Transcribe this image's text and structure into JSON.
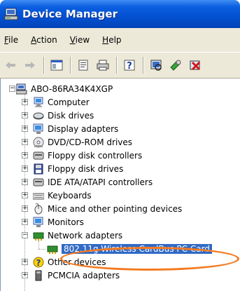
{
  "window": {
    "title": "Device Manager",
    "icon": "device-manager-icon"
  },
  "menu": {
    "items": [
      {
        "label": "File",
        "underline": "F",
        "rest": "ile"
      },
      {
        "label": "Action",
        "underline": "A",
        "rest": "ction"
      },
      {
        "label": "View",
        "underline": "V",
        "rest": "iew"
      },
      {
        "label": "Help",
        "underline": "H",
        "rest": "elp"
      }
    ]
  },
  "toolbar": {
    "buttons": [
      "back-arrow-icon",
      "forward-arrow-icon",
      "show-hide-console-tree-icon",
      "properties-icon",
      "print-icon",
      "help-icon",
      "scan-hardware-icon",
      "update-driver-icon",
      "uninstall-icon"
    ]
  },
  "tree": {
    "root": "ABO-86RA34K4XGP",
    "items": [
      {
        "label": "Computer",
        "icon": "computer-icon"
      },
      {
        "label": "Disk drives",
        "icon": "disk-drive-icon"
      },
      {
        "label": "Display adapters",
        "icon": "display-adapter-icon"
      },
      {
        "label": "DVD/CD-ROM drives",
        "icon": "dvd-drive-icon"
      },
      {
        "label": "Floppy disk controllers",
        "icon": "floppy-controller-icon"
      },
      {
        "label": "Floppy disk drives",
        "icon": "floppy-drive-icon"
      },
      {
        "label": "IDE ATA/ATAPI controllers",
        "icon": "ide-controller-icon"
      },
      {
        "label": "Keyboards",
        "icon": "keyboard-icon"
      },
      {
        "label": "Mice and other pointing devices",
        "icon": "mouse-icon"
      },
      {
        "label": "Monitors",
        "icon": "monitor-icon"
      },
      {
        "label": "Network adapters",
        "icon": "network-adapter-icon"
      },
      {
        "label": "802.11g Wireless CardBus PC Card",
        "icon": "network-card-icon"
      },
      {
        "label": "Other devices",
        "icon": "unknown-device-icon"
      },
      {
        "label": "PCMCIA adapters",
        "icon": "pcmcia-icon"
      }
    ]
  },
  "colors": {
    "title_bar": "#0351d1",
    "selection": "#316ac5",
    "highlight": "#f47a20"
  }
}
